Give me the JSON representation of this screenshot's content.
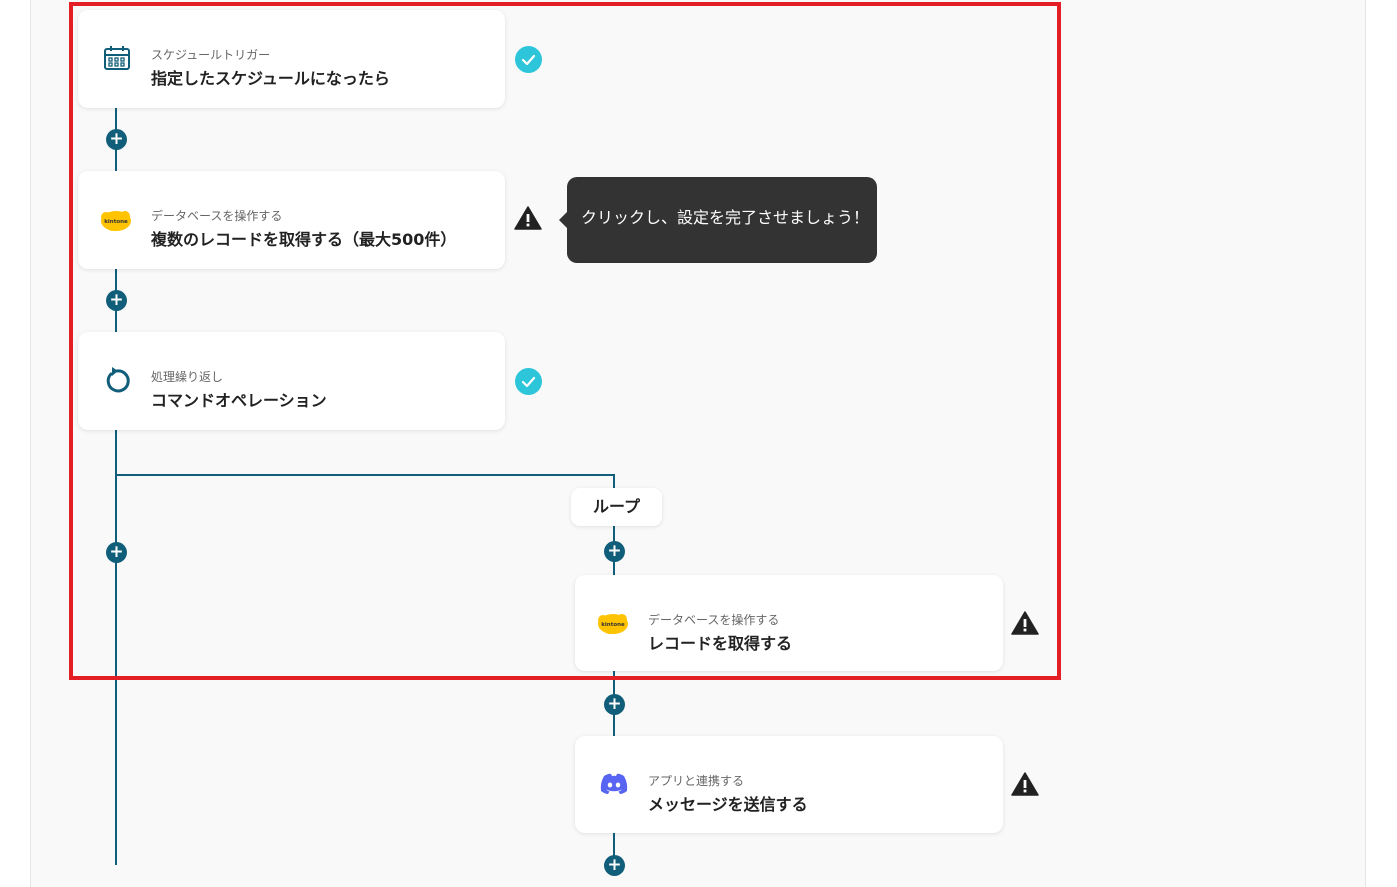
{
  "steps": [
    {
      "sub": "スケジュールトリガー",
      "title": "指定したスケジュールになったら",
      "icon": "calendar-icon",
      "status": "complete"
    },
    {
      "sub": "データベースを操作する",
      "title": "複数のレコードを取得する（最大500件）",
      "icon": "kintone-icon",
      "status": "warning"
    },
    {
      "sub": "処理繰り返し",
      "title": "コマンドオペレーション",
      "icon": "loop-icon",
      "status": "complete"
    },
    {
      "sub": "データベースを操作する",
      "title": "レコードを取得する",
      "icon": "kintone-icon",
      "status": "warning"
    },
    {
      "sub": "アプリと連携する",
      "title": "メッセージを送信する",
      "icon": "discord-icon",
      "status": "warning"
    }
  ],
  "tooltip": {
    "text": "クリックし、設定を完了させましょう！"
  },
  "loop": {
    "label": "ループ"
  },
  "kintone_logo_text": "kintone",
  "plus_symbol": "+",
  "colors": {
    "line": "#115e7a",
    "check": "#2cc5d9",
    "highlight": "#e31e24",
    "kintone": "#ffc300",
    "discord": "#5865f2",
    "tooltip_bg": "#333333"
  }
}
